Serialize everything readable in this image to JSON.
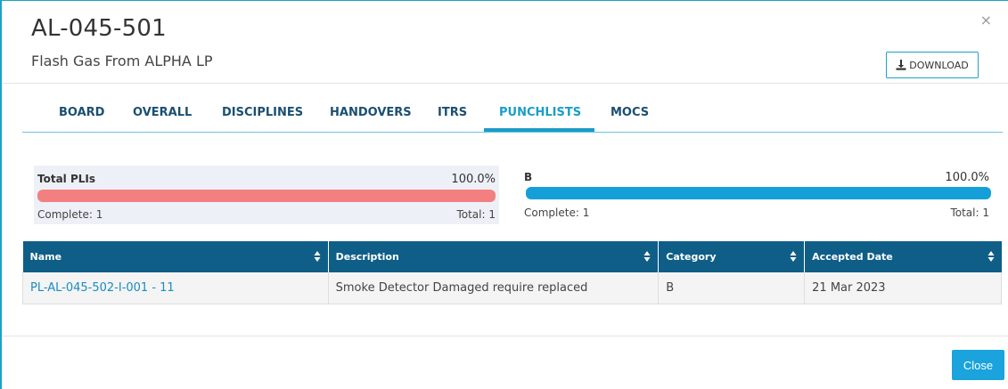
{
  "header": {
    "title": "AL-045-501",
    "subtitle": "Flash Gas From ALPHA LP",
    "close_symbol": "×",
    "download_label": "DOWNLOAD"
  },
  "tabs": [
    {
      "label": "BOARD"
    },
    {
      "label": "OVERALL"
    },
    {
      "label": "DISCIPLINES"
    },
    {
      "label": "HANDOVERS"
    },
    {
      "label": "ITRS"
    },
    {
      "label": "PUNCHLISTS",
      "active": true
    },
    {
      "label": "MOCS"
    }
  ],
  "stats": [
    {
      "label": "Total PLIs",
      "percent": "100.0%",
      "complete": "Complete: 1",
      "total": "Total: 1",
      "fill": 1.0,
      "color": "#f38080"
    },
    {
      "label": "B",
      "percent": "100.0%",
      "complete": "Complete: 1",
      "total": "Total: 1",
      "fill": 1.0,
      "color": "#159fd8"
    }
  ],
  "table": {
    "columns": [
      "Name",
      "Description",
      "Category",
      "Accepted Date"
    ],
    "rows": [
      [
        "PL-AL-045-502-I-001 - 11",
        "Smoke Detector Damaged require replaced",
        "B",
        "21 Mar 2023"
      ]
    ]
  },
  "footer": {
    "close_label": "Close"
  },
  "colors": {
    "accent": "#1aa3dc",
    "table_header": "#0f5e88",
    "tab_inactive": "#1b4f72",
    "tab_active": "#1a9dc8"
  }
}
